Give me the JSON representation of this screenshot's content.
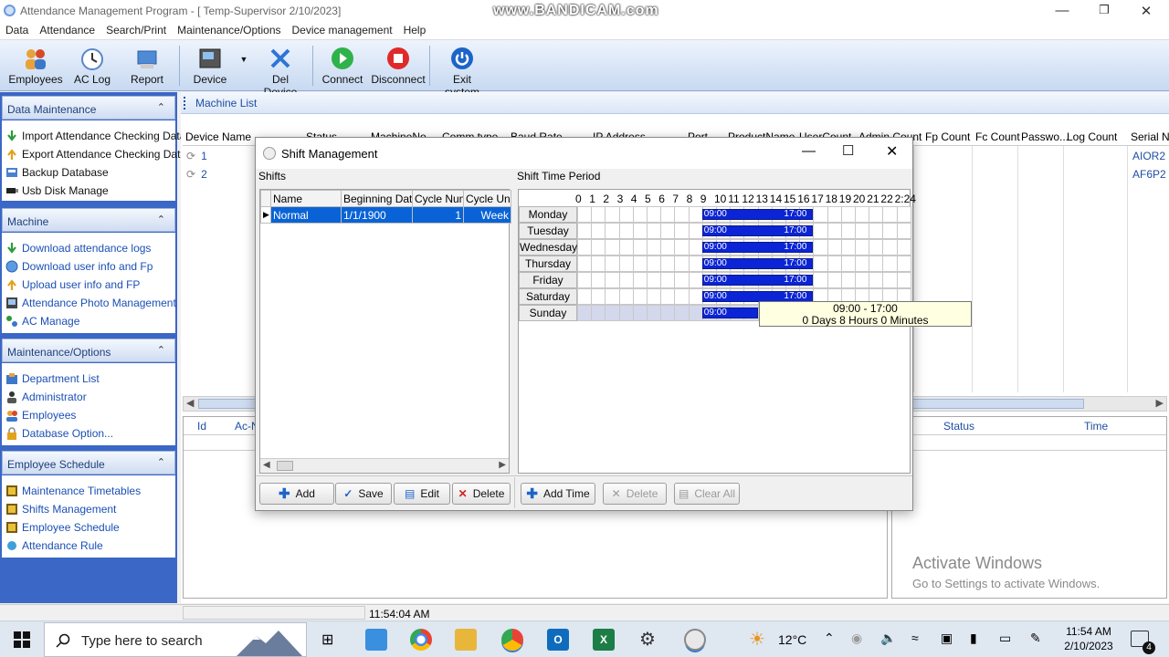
{
  "window": {
    "title": "Attendance Management Program - [ Temp-Supervisor 2/10/2023]",
    "watermark": "www.BANDICAM.com"
  },
  "menu": [
    "Data",
    "Attendance",
    "Search/Print",
    "Maintenance/Options",
    "Device management",
    "Help"
  ],
  "toolbar": {
    "employees": "Employees",
    "ac_log": "AC Log",
    "report": "Report",
    "device": "Device",
    "del_device": "Del Device",
    "connect": "Connect",
    "disconnect": "Disconnect",
    "exit": "Exit system"
  },
  "sidebar": {
    "data_maintenance": {
      "title": "Data Maintenance",
      "items": [
        "Import Attendance Checking Data",
        "Export Attendance Checking Data",
        "Backup Database",
        "Usb Disk Manage"
      ]
    },
    "machine": {
      "title": "Machine",
      "items": [
        "Download attendance logs",
        "Download user info and Fp",
        "Upload user info and FP",
        "Attendance Photo Management",
        "AC Manage"
      ]
    },
    "maintenance": {
      "title": "Maintenance/Options",
      "items": [
        "Department List",
        "Administrator",
        "Employees",
        "Database Option..."
      ]
    },
    "schedule": {
      "title": "Employee Schedule",
      "items": [
        "Maintenance Timetables",
        "Shifts Management",
        "Employee Schedule",
        "Attendance Rule"
      ]
    }
  },
  "machine_list": {
    "title": "Machine List",
    "columns": [
      "Device Name",
      "Status",
      "MachineNo",
      "Comm type",
      "Baud Rate",
      "IP Address",
      "Port",
      "ProductName",
      "UserCount",
      "Admin Count",
      "Fp Count",
      "Fc Count",
      "Passwo...",
      "Log Count",
      "Serial N"
    ],
    "rows": [
      {
        "name": "1",
        "serial": "AIOR2"
      },
      {
        "name": "2",
        "serial": "AF6P2"
      }
    ]
  },
  "lower_left": {
    "columns": [
      "Id",
      "Ac-N"
    ]
  },
  "lower_right": {
    "columns": [
      "Status",
      "Time"
    ]
  },
  "activate": {
    "title": "Activate Windows",
    "subtitle": "Go to Settings to activate Windows."
  },
  "status": {
    "time": "11:54:04 AM"
  },
  "dialog": {
    "title": "Shift Management",
    "shifts_label": "Shifts",
    "period_label": "Shift Time Period",
    "shift_columns": [
      "Name",
      "Beginning Date",
      "Cycle Num",
      "Cycle Unit"
    ],
    "shift_rows": [
      {
        "name": "Normal",
        "date": "1/1/1900",
        "cycle_num": "1",
        "cycle_unit": "Week"
      }
    ],
    "hours": [
      "0",
      "1",
      "2",
      "3",
      "4",
      "5",
      "6",
      "7",
      "8",
      "9",
      "10",
      "11",
      "12",
      "13",
      "14",
      "15",
      "16",
      "17",
      "18",
      "19",
      "20",
      "21",
      "22",
      "2:24"
    ],
    "days": [
      {
        "name": "Monday",
        "start": "09:00",
        "end": "17:00"
      },
      {
        "name": "Tuesday",
        "start": "09:00",
        "end": "17:00"
      },
      {
        "name": "Wednesday",
        "start": "09:00",
        "end": "17:00"
      },
      {
        "name": "Thursday",
        "start": "09:00",
        "end": "17:00"
      },
      {
        "name": "Friday",
        "start": "09:00",
        "end": "17:00"
      },
      {
        "name": "Saturday",
        "start": "09:00",
        "end": "17:00"
      },
      {
        "name": "Sunday",
        "start": "09:00",
        "end": ""
      }
    ],
    "tooltip": {
      "range": "09:00 - 17:00",
      "duration": "0 Days 8 Hours 0 Minutes"
    },
    "buttons": {
      "add": "Add",
      "save": "Save",
      "edit": "Edit",
      "delete": "Delete",
      "add_time": "Add Time",
      "delete_time": "Delete",
      "clear_all": "Clear All"
    }
  },
  "taskbar": {
    "search_placeholder": "Type here to search",
    "temp": "12°C",
    "time": "11:54 AM",
    "date": "2/10/2023",
    "notifications": "4"
  }
}
